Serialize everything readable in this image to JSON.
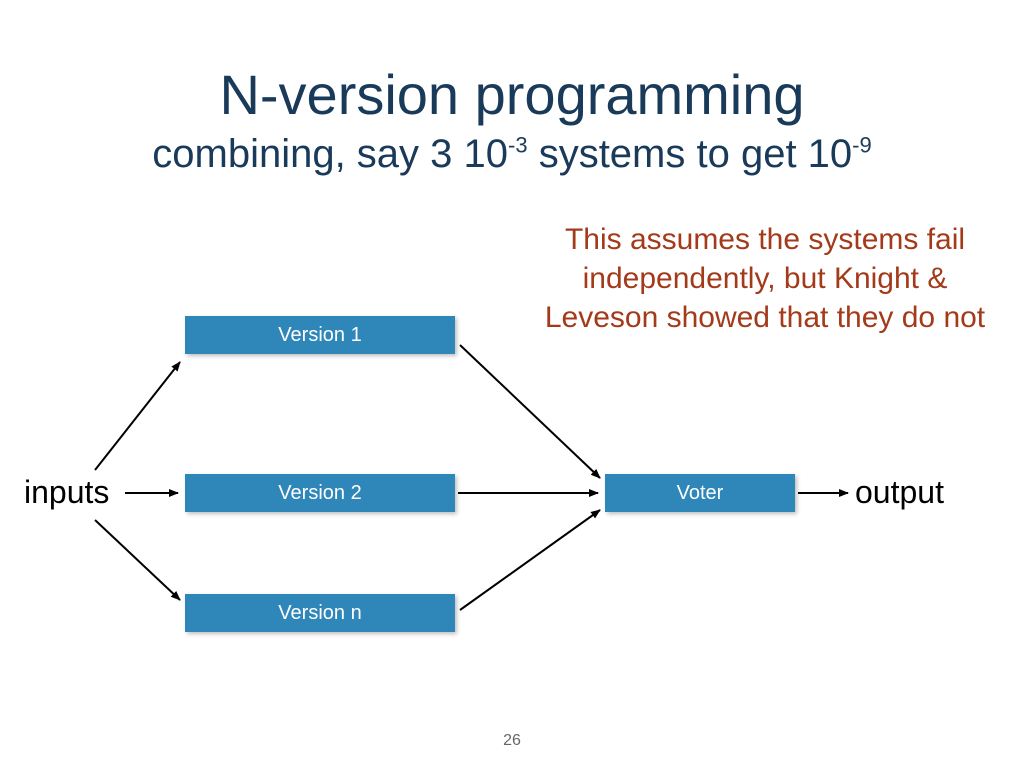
{
  "title": "N-version programming",
  "subtitle_pre": "combining, say 3 10",
  "subtitle_exp1": "-3",
  "subtitle_mid": " systems to get 10",
  "subtitle_exp2": "-9",
  "note": "This assumes the systems fail independently, but Knight & Leveson showed that they do not",
  "boxes": {
    "v1": "Version 1",
    "v2": "Version 2",
    "vn": "Version n",
    "voter": "Voter"
  },
  "labels": {
    "inputs": "inputs",
    "output": "output"
  },
  "page_number": "26"
}
